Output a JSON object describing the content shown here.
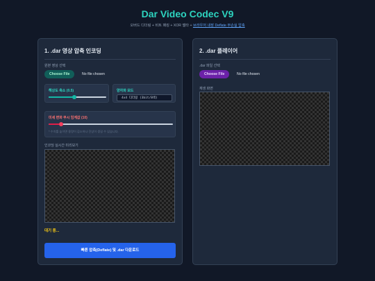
{
  "header": {
    "title": "Dar Video Codec V9",
    "subtitle_plain": "오버드 디더링 + 비트 패킹 + XOR 델타 + ",
    "subtitle_link": "브라우저 내장 Deflate 무손실 압축"
  },
  "encoder": {
    "title": "1. .dar 영상 압축 인코딩",
    "source_label": "원본 영상 선택",
    "file_button": "Choose File",
    "file_status": "No file chosen",
    "scale_label": "해상도 축소 (0.5)",
    "scale_value": 0.5,
    "quant_label": "양자화 모드",
    "quant_selected": "4x4 디더링 (3bit/8색)",
    "threshold_label": "미세 변화 무시 임계값 (10)",
    "threshold_value": 10,
    "hint": "* 수치를 높이면 용량이 감소하나 잔상이 생길 수 있습니다.",
    "preview_label": "인코딩 실시간 미리보기",
    "status": "대기 중...",
    "submit_button": "빠른 압축(Deflate) 및 .dar 다운로드"
  },
  "player": {
    "title": "2. .dar 플레이어",
    "file_label": ".dar 파일 선택",
    "file_button": "Choose File",
    "file_status": "No file chosen",
    "screen_label": "재생 화면"
  },
  "colors": {
    "accent_teal": "#2dd4bf",
    "accent_red": "#f87171",
    "primary_blue": "#2563eb",
    "status_yellow": "#facc15"
  }
}
